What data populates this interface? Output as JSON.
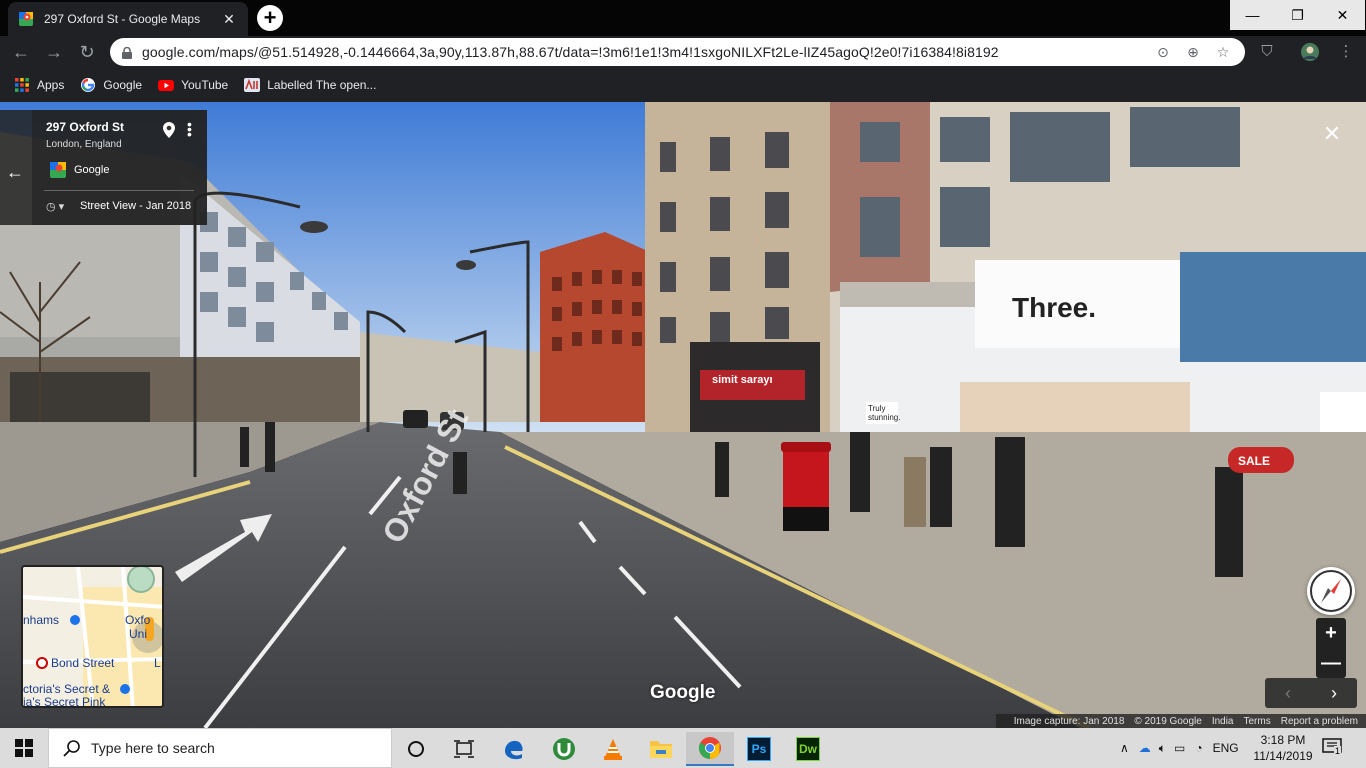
{
  "browser": {
    "tab_title": "297 Oxford St - Google Maps",
    "tab_close": "✕",
    "new_tab": "+",
    "url": "google.com/maps/@51.514928,-0.1446664,3a,90y,113.87h,88.67t/data=!3m6!1e1!3m4!1sxgoNILXFt2Le-lIZ45agoQ!2e0!7i16384!8i8192",
    "window_controls": {
      "minimize": "—",
      "restore": "❐",
      "close": "✕"
    },
    "bookmarks": [
      {
        "label": "Apps",
        "icon": "apps-grid-icon"
      },
      {
        "label": "Google",
        "icon": "google-g-icon"
      },
      {
        "label": "YouTube",
        "icon": "youtube-icon"
      },
      {
        "label": "Labelled The open...",
        "icon": "labelled-icon"
      }
    ]
  },
  "streetview": {
    "address": "297 Oxford St",
    "city": "London, England",
    "provider": "Google",
    "date_label": "Street View - Jan 2018",
    "watermark": "Google",
    "minimap": {
      "labels": [
        "nhams",
        "Oxfo",
        "Uni",
        "Bond Street",
        "L",
        "ctoria's Secret &",
        "ia's Secret Pink"
      ]
    },
    "zoom_in": "+",
    "zoom_out": "—",
    "prev": "‹",
    "next": "›",
    "footer": {
      "capture": "Image capture: Jan 2018",
      "copyright": "© 2019 Google",
      "region": "India",
      "terms": "Terms",
      "report": "Report a problem"
    },
    "street_sign": "Oxford St",
    "shop_signs": {
      "three": "Three.",
      "simit": "simit sarayı",
      "poster": "Truly stunning.",
      "sale": "SALE"
    }
  },
  "taskbar": {
    "search_placeholder": "Type here to search",
    "language": "ENG",
    "time": "3:18 PM",
    "date": "11/14/2019",
    "notification_count": "1",
    "apps": [
      "cortana-icon",
      "task-view-icon",
      "edge-icon",
      "utorrent-icon",
      "vlc-icon",
      "file-explorer-icon",
      "chrome-icon",
      "photoshop-icon",
      "dreamweaver-icon"
    ],
    "ps_label": "Ps",
    "dw_label": "Dw"
  },
  "colors": {
    "chrome_dark": "#202124",
    "accent_blue": "#1a73e8",
    "taskbar": "#dcdcdc"
  }
}
